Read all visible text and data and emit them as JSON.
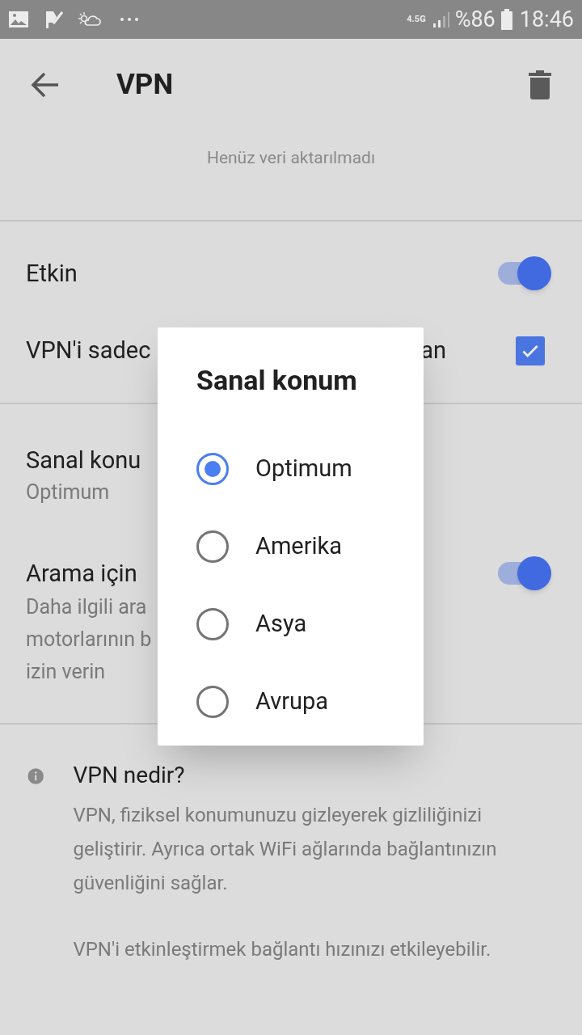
{
  "status_bar": {
    "network": "4.5G",
    "battery": "%86",
    "time": "18:46"
  },
  "toolbar": {
    "title": "VPN"
  },
  "data_note": "Henüz veri aktarılmadı",
  "settings": [
    {
      "kind": "switch",
      "label": "Etkin",
      "on": true
    },
    {
      "kind": "checkbox",
      "label_start": "VPN'i sadec",
      "label_end": "an",
      "checked": true
    },
    {
      "kind": "value",
      "label": "Sanal konu",
      "value": "Optimum"
    },
    {
      "kind": "switch",
      "label": "Arama için",
      "description_lines": [
        "Daha ilgili ara",
        "motorlarının b",
        "izin verin"
      ],
      "on": true
    }
  ],
  "info": {
    "title": "VPN nedir?",
    "paragraphs": [
      "VPN, fiziksel konumunuzu gizleyerek gizliliğinizi geliştirir. Ayrıca ortak WiFi ağlarında bağlantınızın güvenliğini sağlar.",
      "VPN'i etkinleştirmek bağlantı hızınızı etkileyebilir."
    ]
  },
  "dialog": {
    "title": "Sanal konum",
    "options": [
      {
        "label": "Optimum",
        "selected": true
      },
      {
        "label": "Amerika",
        "selected": false
      },
      {
        "label": "Asya",
        "selected": false
      },
      {
        "label": "Avrupa",
        "selected": false
      }
    ]
  }
}
